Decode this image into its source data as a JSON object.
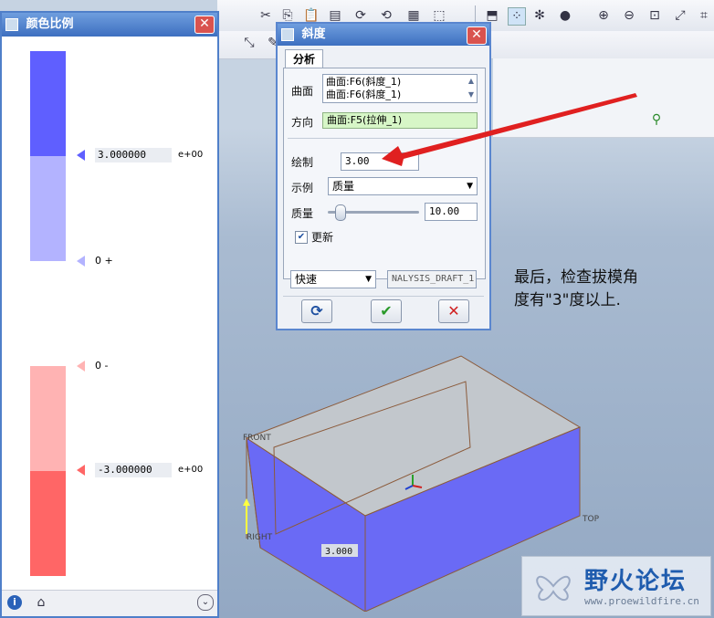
{
  "scale_window": {
    "title": "颜色比例",
    "bands": [
      "#5f5fff",
      "#b3b3ff",
      "#ffffff",
      "#ffb3b3",
      "#ff6666"
    ],
    "marker_1_value": "3.000000",
    "marker_1_exp": "e+00",
    "marker_2_label": "0 +",
    "marker_3_label": "0 -",
    "marker_4_value": "-3.000000",
    "marker_4_exp": "e+00"
  },
  "draft_dialog": {
    "title": "斜度",
    "tab_analysis": "分析",
    "surface_label": "曲面",
    "surface_items": [
      "曲面:F6(斜度_1)",
      "曲面:F6(斜度_1)"
    ],
    "direction_label": "方向",
    "direction_value": "曲面:F5(拉伸_1)",
    "plot_label": "绘制",
    "plot_value": "3.00",
    "sample_label": "示例",
    "sample_value": "质量",
    "quality_label": "质量",
    "quality_value": "10.00",
    "update_label": "更新",
    "update_checked": true,
    "mode_value": "快速",
    "analysis_name": "NALYSIS_DRAFT_1"
  },
  "annotation": {
    "line1": "最后，检查拔模角",
    "line2": "度有\"3\"度以上."
  },
  "model_labels": {
    "front": "FRONT",
    "top": "TOP",
    "right": "RIGHT",
    "dimension": "3.000"
  },
  "watermark": {
    "name": "野火论坛",
    "url": "www.proewildfire.cn"
  },
  "colors": {
    "model_face": "#6a6af5",
    "arrow": "#e02020",
    "title_bar": "#3d6fc0"
  }
}
